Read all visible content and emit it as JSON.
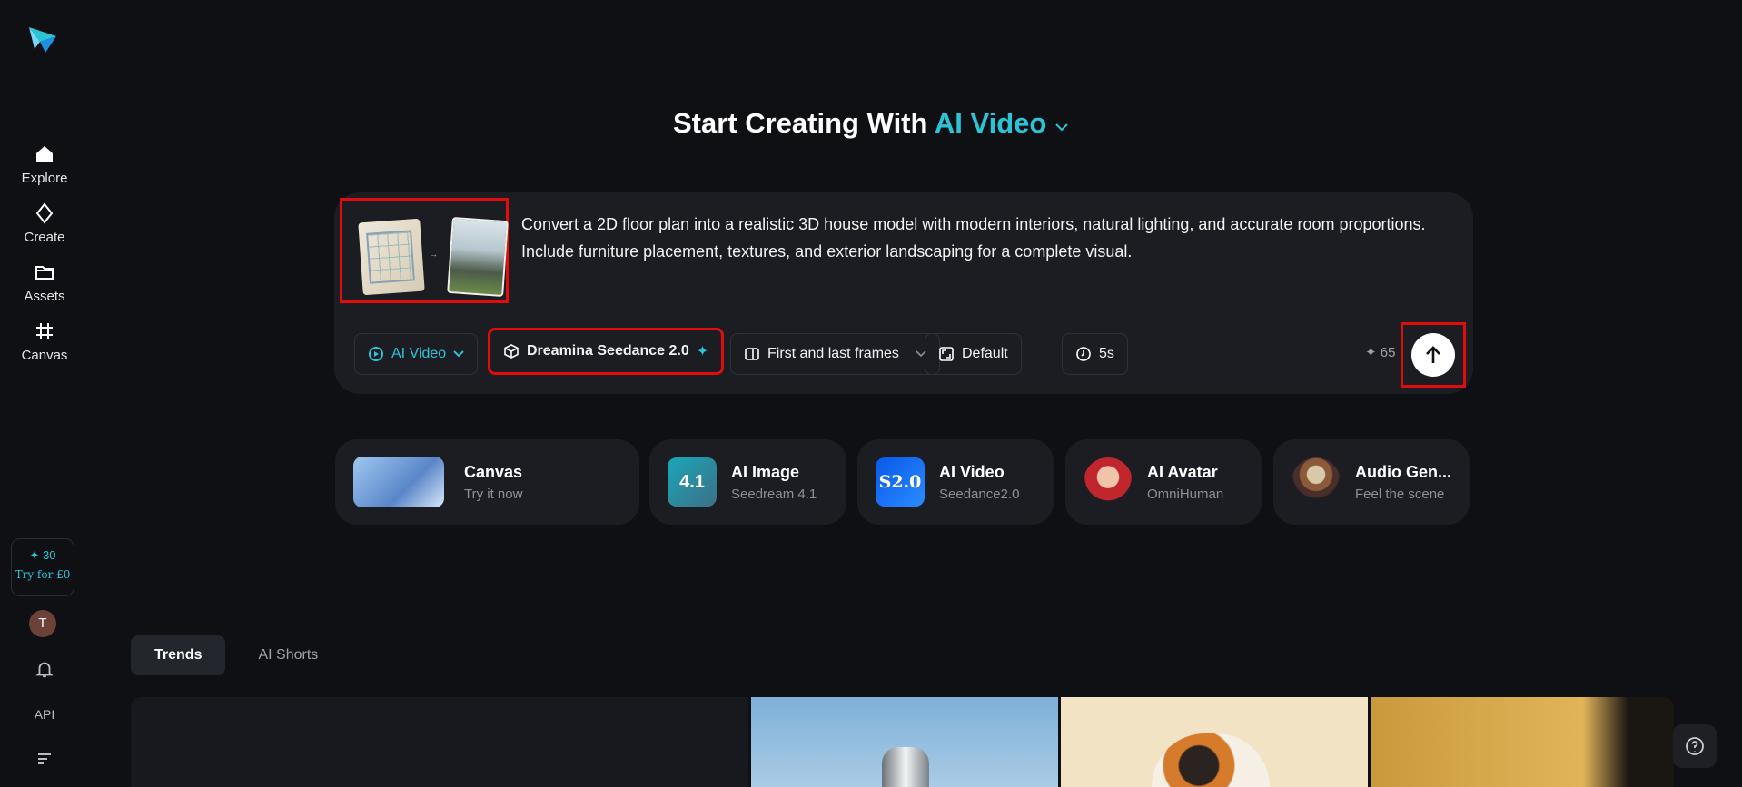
{
  "sidebar": {
    "items": [
      {
        "label": "Explore",
        "icon": "home-icon"
      },
      {
        "label": "Create",
        "icon": "diamond-icon"
      },
      {
        "label": "Assets",
        "icon": "folder-icon"
      },
      {
        "label": "Canvas",
        "icon": "hash-icon"
      }
    ],
    "promo": {
      "points": "✦ 30",
      "cta": "Try for £0"
    },
    "avatar_letter": "T",
    "api_label": "API"
  },
  "hero": {
    "prefix": "Start Creating With ",
    "accent": "AI Video"
  },
  "prompt": {
    "text": "Convert a 2D floor plan into a realistic 3D house model with modern interiors, natural lighting, and accurate room proportions. Include furniture placement, textures, and exterior landscaping for a complete visual.",
    "toolbar": {
      "mode": "AI Video",
      "model": "Dreamina Seedance 2.0",
      "frames": "First and last frames",
      "ratio": "Default",
      "duration": "5s",
      "credits": "✦ 65"
    }
  },
  "shortcuts": [
    {
      "title": "Canvas",
      "sub": "Try it now"
    },
    {
      "title": "AI Image",
      "sub": "Seedream 4.1",
      "badge": "4.1"
    },
    {
      "title": "AI Video",
      "sub": "Seedance2.0",
      "badge": "S2.0"
    },
    {
      "title": "AI Avatar",
      "sub": "OmniHuman"
    },
    {
      "title": "Audio Gen...",
      "sub": "Feel the scene"
    }
  ],
  "tabs": [
    "Trends",
    "AI Shorts"
  ],
  "colors": {
    "accent": "#2bc3d6",
    "highlight": "#e10d0d",
    "background": "#0f1014",
    "card": "#1b1d23"
  }
}
